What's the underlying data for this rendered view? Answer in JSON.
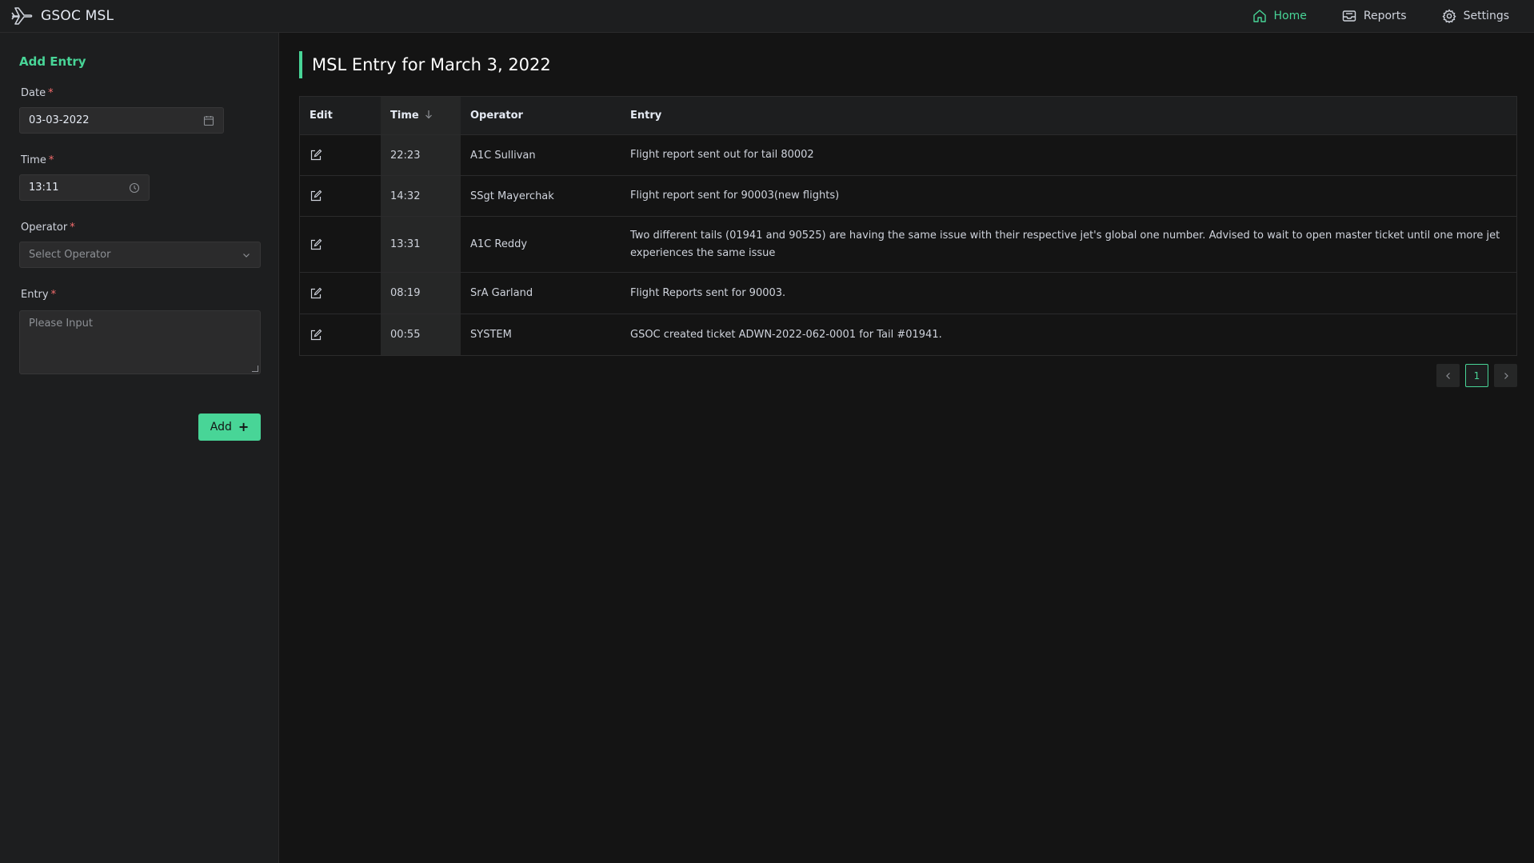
{
  "app": {
    "title": "GSOC MSL"
  },
  "nav": {
    "items": [
      {
        "label": "Home",
        "icon": "home-icon",
        "active": true
      },
      {
        "label": "Reports",
        "icon": "inbox-icon",
        "active": false
      },
      {
        "label": "Settings",
        "icon": "gear-icon",
        "active": false
      }
    ]
  },
  "form": {
    "title": "Add Entry",
    "required_mark": "*",
    "date": {
      "label": "Date",
      "value": "03-03-2022",
      "icon": "calendar-icon"
    },
    "time": {
      "label": "Time",
      "value": "13:11",
      "icon": "clock-icon"
    },
    "operator": {
      "label": "Operator",
      "placeholder": "Select Operator",
      "icon": "chevron-down-icon"
    },
    "entry": {
      "label": "Entry",
      "placeholder": "Please Input"
    },
    "add_button": {
      "label": "Add",
      "icon": "plus-icon"
    }
  },
  "main": {
    "title": "MSL Entry for March 3, 2022",
    "columns": {
      "edit": "Edit",
      "time": "Time",
      "operator": "Operator",
      "entry": "Entry"
    },
    "rows": [
      {
        "time": "22:23",
        "operator": "A1C Sullivan",
        "entry": "Flight report sent out for tail 80002"
      },
      {
        "time": "14:32",
        "operator": "SSgt Mayerchak",
        "entry": "Flight report sent for 90003(new flights)"
      },
      {
        "time": "13:31",
        "operator": "A1C Reddy",
        "entry": "Two different tails (01941 and 90525) are having the same issue with their respective jet's global one number. Advised to wait to open master ticket until one more jet experiences the same issue"
      },
      {
        "time": "08:19",
        "operator": "SrA Garland",
        "entry": "Flight Reports sent for 90003."
      },
      {
        "time": "00:55",
        "operator": "SYSTEM",
        "entry": "GSOC created ticket ADWN-2022-062-0001 for Tail #01941."
      }
    ]
  },
  "pagination": {
    "current": "1"
  },
  "colors": {
    "accent": "#48d597",
    "background": "#141414",
    "panel": "#1d1e1f",
    "required": "#f56c6c"
  }
}
